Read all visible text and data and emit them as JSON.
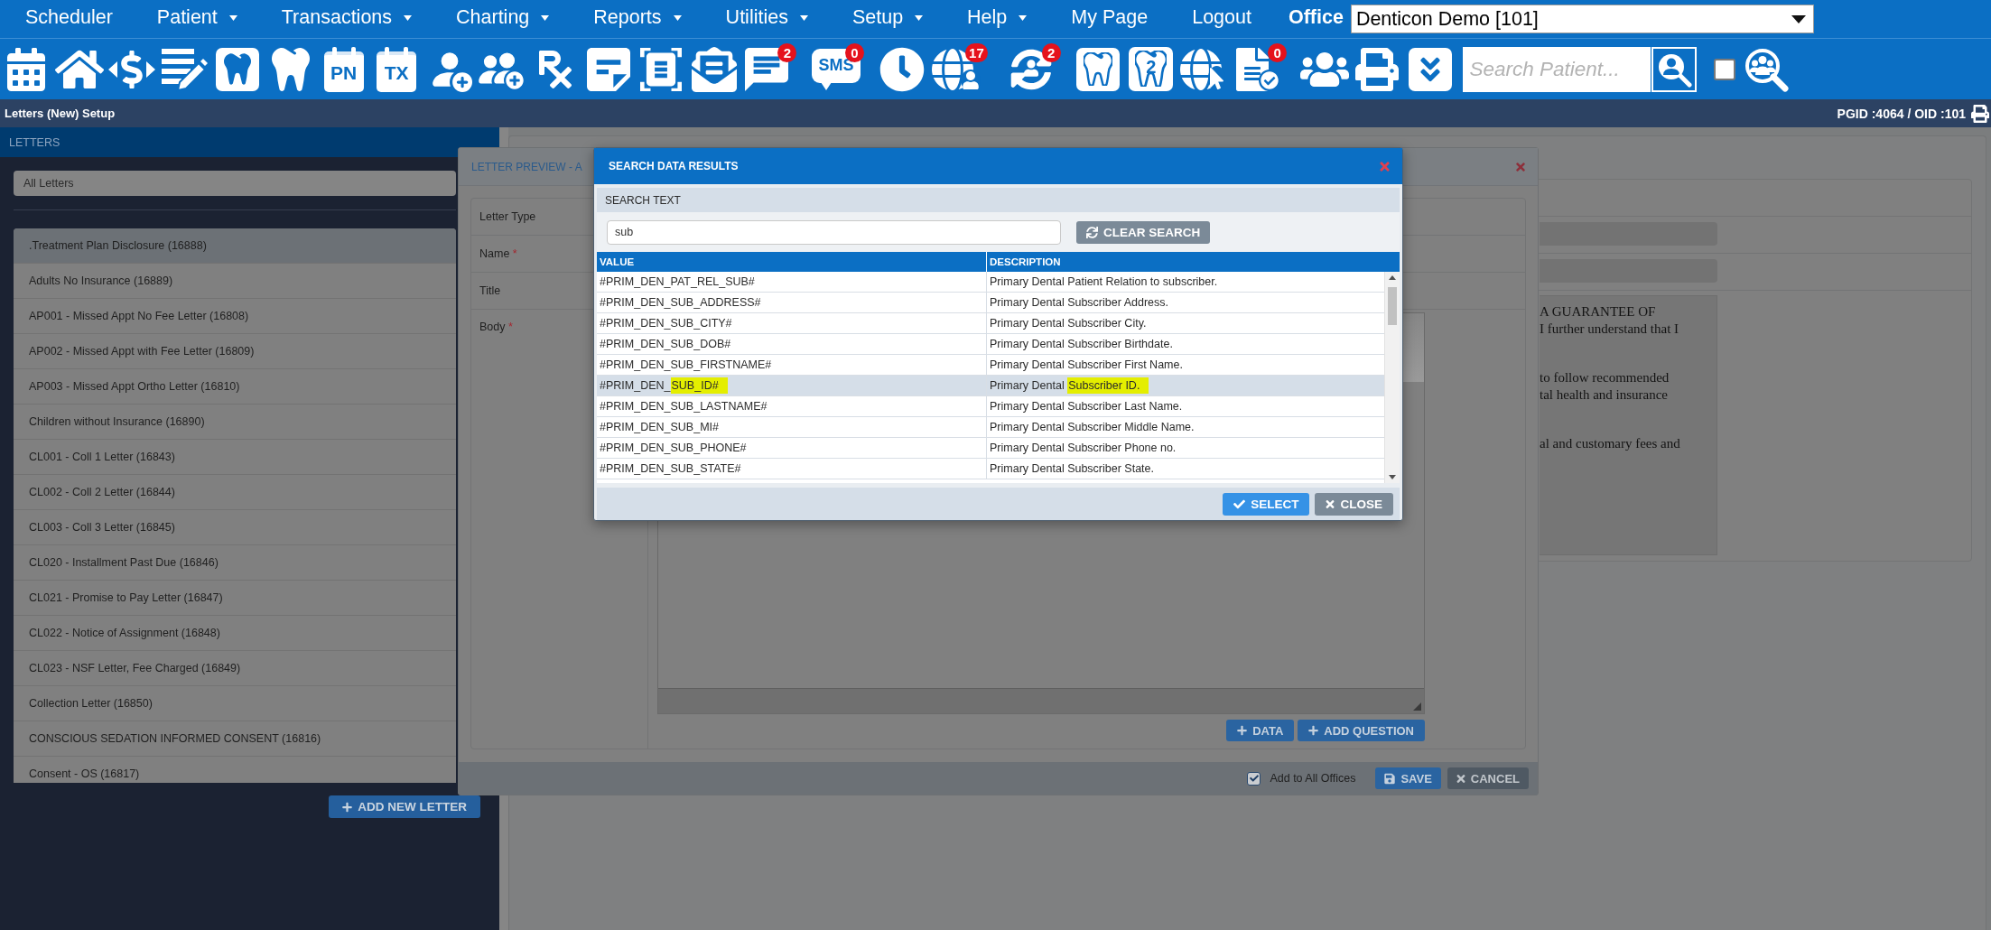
{
  "menu_bar": {
    "items": [
      {
        "label": "Scheduler",
        "dropdown": false
      },
      {
        "label": "Patient",
        "dropdown": true
      },
      {
        "label": "Transactions",
        "dropdown": true
      },
      {
        "label": "Charting",
        "dropdown": true
      },
      {
        "label": "Reports",
        "dropdown": true
      },
      {
        "label": "Utilities",
        "dropdown": true
      },
      {
        "label": "Setup",
        "dropdown": true
      },
      {
        "label": "Help",
        "dropdown": true
      },
      {
        "label": "My Page",
        "dropdown": false
      },
      {
        "label": "Logout",
        "dropdown": false
      }
    ],
    "office": {
      "label": "Office",
      "value": "Denticon Demo [101]"
    }
  },
  "toolbar": {
    "buttons": [
      {
        "kind": "calendar"
      },
      {
        "kind": "home"
      },
      {
        "kind": "money"
      },
      {
        "kind": "edit_list"
      },
      {
        "kind": "tooth_solid_tile"
      },
      {
        "kind": "tooth"
      },
      {
        "kind": "calendar_text",
        "label": "PN"
      },
      {
        "kind": "calendar_text",
        "label": "TX"
      },
      {
        "kind": "add_person"
      },
      {
        "kind": "add_people"
      },
      {
        "kind": "rx"
      },
      {
        "kind": "note"
      },
      {
        "kind": "scan"
      },
      {
        "kind": "mail"
      },
      {
        "kind": "chat",
        "badge": "2"
      },
      {
        "kind": "sms",
        "label": "SMS",
        "badge": "0"
      },
      {
        "kind": "clock"
      },
      {
        "kind": "globe_person",
        "badge": "17"
      },
      {
        "kind": "sync_person",
        "badge": "2"
      },
      {
        "kind": "tooth_tile"
      },
      {
        "kind": "tooth_number",
        "label": "2"
      },
      {
        "kind": "globe_pointer"
      },
      {
        "kind": "doc_check",
        "badge": "0"
      },
      {
        "kind": "people"
      },
      {
        "kind": "print"
      },
      {
        "kind": "more"
      }
    ],
    "search": {
      "placeholder": "Search Patient...",
      "checked": false
    }
  },
  "header_bar": {
    "title": "Letters (New) Setup",
    "ids": "PGID :4064 / OID :101"
  },
  "letters_panel": {
    "title": "LETTERS",
    "filter": "All Letters",
    "items": [
      {
        "label": ".Treatment Plan Disclosure (16888)",
        "selected": true
      },
      {
        "label": "Adults No Insurance (16889)",
        "selected": false
      },
      {
        "label": "AP001 - Missed Appt No Fee Letter (16808)",
        "selected": false
      },
      {
        "label": "AP002 - Missed Appt with Fee Letter (16809)",
        "selected": false
      },
      {
        "label": "AP003 - Missed Appt Ortho Letter (16810)",
        "selected": false
      },
      {
        "label": "Children without Insurance (16890)",
        "selected": false
      },
      {
        "label": "CL001 - Coll 1 Letter (16843)",
        "selected": false
      },
      {
        "label": "CL002 - Coll 2 Letter (16844)",
        "selected": false
      },
      {
        "label": "CL003 - Coll 3 Letter (16845)",
        "selected": false
      },
      {
        "label": "CL020 - Installment Past Due (16846)",
        "selected": false
      },
      {
        "label": "CL021 - Promise to Pay Letter (16847)",
        "selected": false
      },
      {
        "label": "CL022 - Notice of Assignment (16848)",
        "selected": false
      },
      {
        "label": "CL023 - NSF Letter, Fee Charged (16849)",
        "selected": false
      },
      {
        "label": "Collection Letter (16850)",
        "selected": false
      },
      {
        "label": "CONSCIOUS SEDATION INFORMED CONSENT (16816)",
        "selected": false
      },
      {
        "label": "Consent - OS (16817)",
        "selected": false
      }
    ],
    "add_button": "ADD NEW LETTER"
  },
  "background_form": {
    "paragraphs": [
      [
        "A GUARANTEE OF",
        "I further understand that I"
      ],
      [
        "to follow recommended",
        "tal health and insurance"
      ],
      [
        "al and customary fees and"
      ]
    ]
  },
  "letter_preview": {
    "title": "LETTER PREVIEW - A",
    "fields": [
      {
        "label": "Letter Type",
        "kind": "field"
      },
      {
        "label": "Name",
        "mark": "*",
        "kind": "field"
      },
      {
        "label": "Title",
        "kind": "field"
      },
      {
        "label": "Body",
        "mark": "*",
        "kind": "editor"
      }
    ],
    "body_buttons": [
      "DATA",
      "ADD QUESTION"
    ],
    "add_to_all_offices": {
      "label": "Add to All Offices",
      "checked": true
    },
    "footer_buttons": [
      {
        "kind": "save",
        "label": "SAVE"
      },
      {
        "kind": "cancel",
        "label": "CANCEL"
      }
    ]
  },
  "search_dialog": {
    "title": "SEARCH DATA RESULTS",
    "search_label": "SEARCH TEXT",
    "search_value": "sub",
    "clear_button": "CLEAR SEARCH",
    "columns": [
      "VALUE",
      "DESCRIPTION"
    ],
    "rows": [
      {
        "value": "#PRIM_DEN_PAT_REL_SUB#",
        "description": "Primary Dental Patient Relation to subscriber.",
        "selected": false
      },
      {
        "value": "#PRIM_DEN_SUB_ADDRESS#",
        "description": "Primary Dental Subscriber Address.",
        "selected": false
      },
      {
        "value": "#PRIM_DEN_SUB_CITY#",
        "description": "Primary Dental Subscriber City.",
        "selected": false
      },
      {
        "value": "#PRIM_DEN_SUB_DOB#",
        "description": "Primary Dental Subscriber Birthdate.",
        "selected": false
      },
      {
        "value": "#PRIM_DEN_SUB_FIRSTNAME#",
        "description": "Primary Dental Subscriber First Name.",
        "selected": false
      },
      {
        "value": "#PRIM_DEN_",
        "value_marked": "SUB_ID#",
        "description": "Primary Dental",
        "description_marked": "Subscriber ID.",
        "selected": true
      },
      {
        "value": "#PRIM_DEN_SUB_LASTNAME#",
        "description": "Primary Dental Subscriber Last Name.",
        "selected": false
      },
      {
        "value": "#PRIM_DEN_SUB_MI#",
        "description": "Primary Dental Subscriber Middle Name.",
        "selected": false
      },
      {
        "value": "#PRIM_DEN_SUB_PHONE#",
        "description": "Primary Dental Subscriber Phone no.",
        "selected": false
      },
      {
        "value": "#PRIM_DEN_SUB_STATE#",
        "description": "Primary Dental Subscriber State.",
        "selected": false
      }
    ],
    "buttons": [
      {
        "kind": "select",
        "label": "SELECT"
      },
      {
        "kind": "close",
        "label": "CLOSE"
      }
    ]
  }
}
